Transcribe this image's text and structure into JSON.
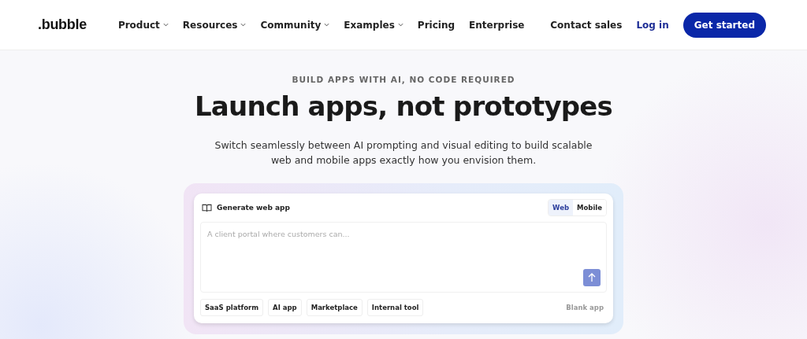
{
  "header": {
    "logo": ".bubble",
    "nav": [
      {
        "label": "Product",
        "has_menu": true
      },
      {
        "label": "Resources",
        "has_menu": true
      },
      {
        "label": "Community",
        "has_menu": true
      },
      {
        "label": "Examples",
        "has_menu": true
      },
      {
        "label": "Pricing",
        "has_menu": false
      },
      {
        "label": "Enterprise",
        "has_menu": false
      }
    ],
    "actions": [
      {
        "label": "Contact sales",
        "kind": "plain"
      },
      {
        "label": "Log in",
        "kind": "link"
      },
      {
        "label": "Get started",
        "kind": "primary"
      }
    ]
  },
  "hero": {
    "eyebrow": "BUILD APPS WITH AI, NO CODE REQUIRED",
    "title": "Launch apps, not prototypes",
    "subtitle": "Switch seamlessly between AI prompting and visual editing to build scalable web and mobile apps exactly how you envision them."
  },
  "generator": {
    "title": "Generate web app",
    "modes": [
      {
        "label": "Web",
        "selected": true
      },
      {
        "label": "Mobile",
        "selected": false
      }
    ],
    "prompt": {
      "placeholder": "A client portal where customers can..."
    },
    "chips": [
      "SaaS platform",
      "AI app",
      "Marketplace",
      "Internal tool"
    ],
    "blank_link": "Blank app"
  }
}
